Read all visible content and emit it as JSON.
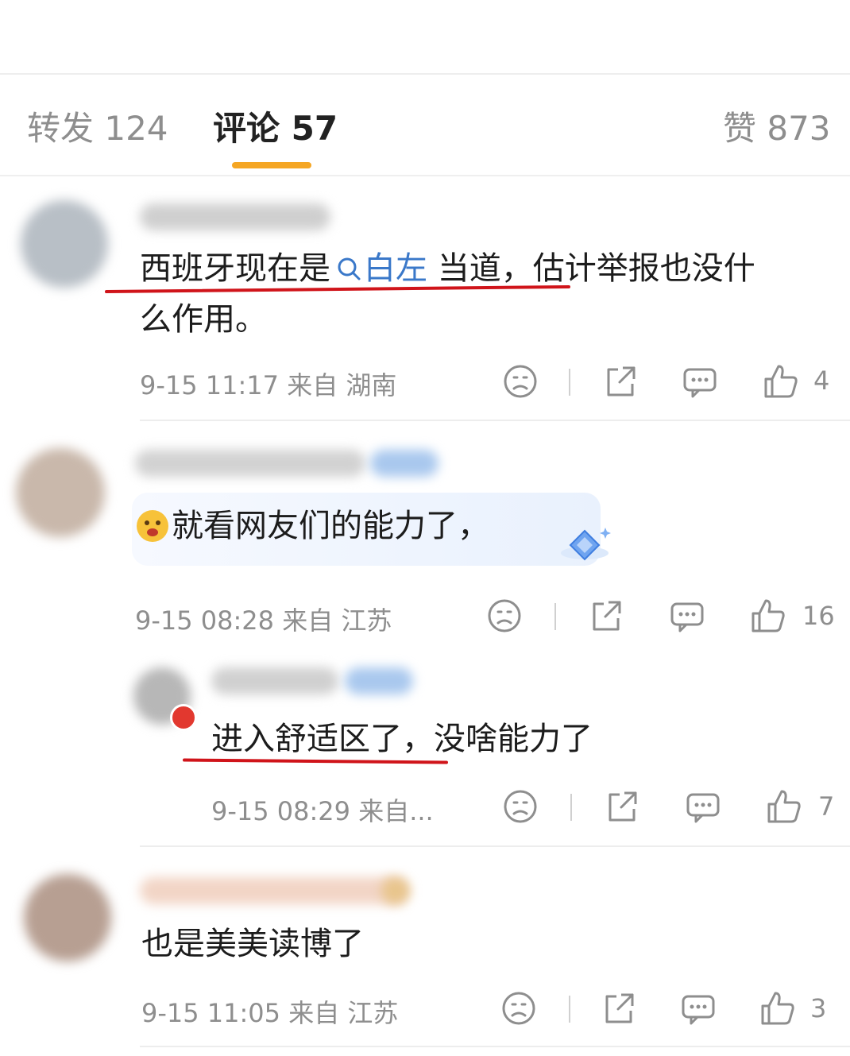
{
  "tabs": {
    "repost": "转发 124",
    "comments": "评论 57",
    "likes": "赞 873"
  },
  "colors": {
    "accent": "#f5a623",
    "underline_red": "#d0141a",
    "topic_blue": "#3a78c9"
  },
  "icons": [
    "dislike-face-icon",
    "share-icon",
    "comment-bubble-icon",
    "thumbs-up-icon",
    "search-icon",
    "sticker-emoji-icon",
    "diamond-badge-icon",
    "vip-badge-icon"
  ],
  "comments": [
    {
      "text_a": "西班牙现在是",
      "topic": "白左",
      "text_b": " 当道，估计举报也没什",
      "text_line2": "么作用。",
      "meta": "9-15 11:17 来自 湖南",
      "likes": "4"
    },
    {
      "text": "就看网友们的能力了，",
      "meta": "9-15 08:28 来自 江苏",
      "likes": "16"
    },
    {
      "text": "进入舒适区了，没啥能力了",
      "meta": "9-15 08:29 来自...",
      "likes": "7"
    },
    {
      "text": "也是美美读博了",
      "meta": "9-15 11:05 来自 江苏",
      "likes": "3"
    }
  ]
}
